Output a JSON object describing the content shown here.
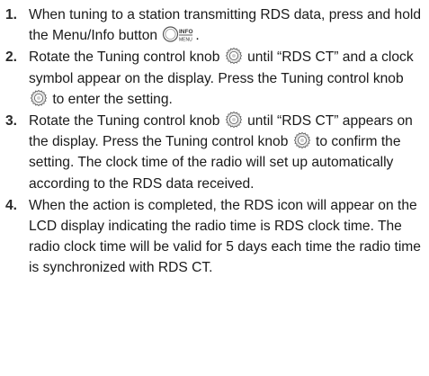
{
  "steps": [
    {
      "number": "1.",
      "parts": [
        "When tuning to a station transmitting RDS data, press and hold the Menu/Info button ",
        "."
      ],
      "menu_icon": {
        "icon": "menu-info-button-icon",
        "top_label": "INFO",
        "bottom_label": "MENU"
      }
    },
    {
      "number": "2.",
      "parts": [
        "Rotate the Tuning control knob ",
        " until “RDS CT” and a clock symbol appear on the display. Press the Tuning control knob ",
        " to enter the setting."
      ]
    },
    {
      "number": "3.",
      "parts": [
        "Rotate the Tuning control knob ",
        " until “RDS CT” appears on the display. Press the Tuning control knob ",
        " to confirm the setting. The clock time of the radio will set up automatically according to the RDS data received."
      ]
    },
    {
      "number": "4.",
      "text": "When the action is completed, the RDS icon will appear on the LCD display indicating the radio time is RDS clock time. The radio clock time will be valid for 5 days each time the radio time is synchronized with RDS CT."
    }
  ],
  "icons": {
    "knob": "tuning-knob-icon"
  },
  "colors": {
    "text": "#1a1a1a",
    "icon_stroke": "#555555",
    "icon_fill": "#e9e9e9"
  }
}
